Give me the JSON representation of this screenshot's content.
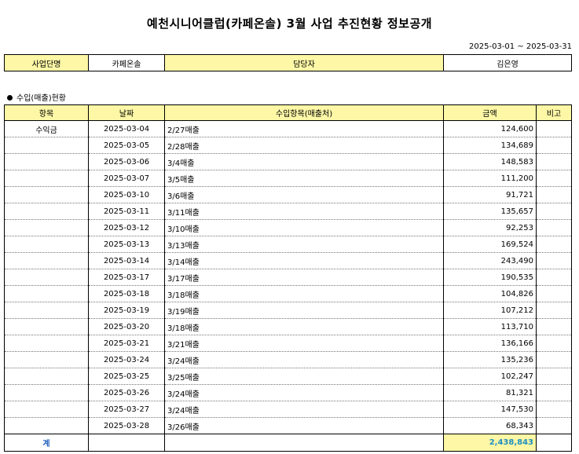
{
  "title": "예천시니어클럽(카페온솔) 3월 사업 추진현황 정보공개",
  "period": "2025-03-01 ~ 2025-03-31",
  "info": {
    "label_project": "사업단명",
    "project_name": "카페온솔",
    "label_manager": "담당자",
    "manager_name": "김은영"
  },
  "section_title": "수입(매출)현황",
  "table": {
    "headers": [
      "항목",
      "날짜",
      "수입항목(매출처)",
      "금액",
      "비고"
    ],
    "category": "수익금",
    "rows": [
      {
        "date": "2025-03-04",
        "item": "2/27매출",
        "amount": "124,600"
      },
      {
        "date": "2025-03-05",
        "item": "2/28매출",
        "amount": "134,689"
      },
      {
        "date": "2025-03-06",
        "item": "3/4매출",
        "amount": "148,583"
      },
      {
        "date": "2025-03-07",
        "item": "3/5매출",
        "amount": "111,200"
      },
      {
        "date": "2025-03-10",
        "item": "3/6매출",
        "amount": "91,721"
      },
      {
        "date": "2025-03-11",
        "item": "3/11매출",
        "amount": "135,657"
      },
      {
        "date": "2025-03-12",
        "item": "3/10매출",
        "amount": "92,253"
      },
      {
        "date": "2025-03-13",
        "item": "3/13매출",
        "amount": "169,524"
      },
      {
        "date": "2025-03-14",
        "item": "3/14매출",
        "amount": "243,490"
      },
      {
        "date": "2025-03-17",
        "item": "3/17매출",
        "amount": "190,535"
      },
      {
        "date": "2025-03-18",
        "item": "3/18매출",
        "amount": "104,826"
      },
      {
        "date": "2025-03-19",
        "item": "3/19매출",
        "amount": "107,212"
      },
      {
        "date": "2025-03-20",
        "item": "3/18매출",
        "amount": "113,710"
      },
      {
        "date": "2025-03-21",
        "item": "3/21매출",
        "amount": "136,166"
      },
      {
        "date": "2025-03-24",
        "item": "3/24매출",
        "amount": "135,236"
      },
      {
        "date": "2025-03-25",
        "item": "3/25매출",
        "amount": "102,247"
      },
      {
        "date": "2025-03-26",
        "item": "3/24매출",
        "amount": "81,321"
      },
      {
        "date": "2025-03-27",
        "item": "3/24매출",
        "amount": "147,530"
      },
      {
        "date": "2025-03-28",
        "item": "3/26매출",
        "amount": "68,343"
      }
    ],
    "total_label": "계",
    "total_amount": "2,438,843"
  }
}
